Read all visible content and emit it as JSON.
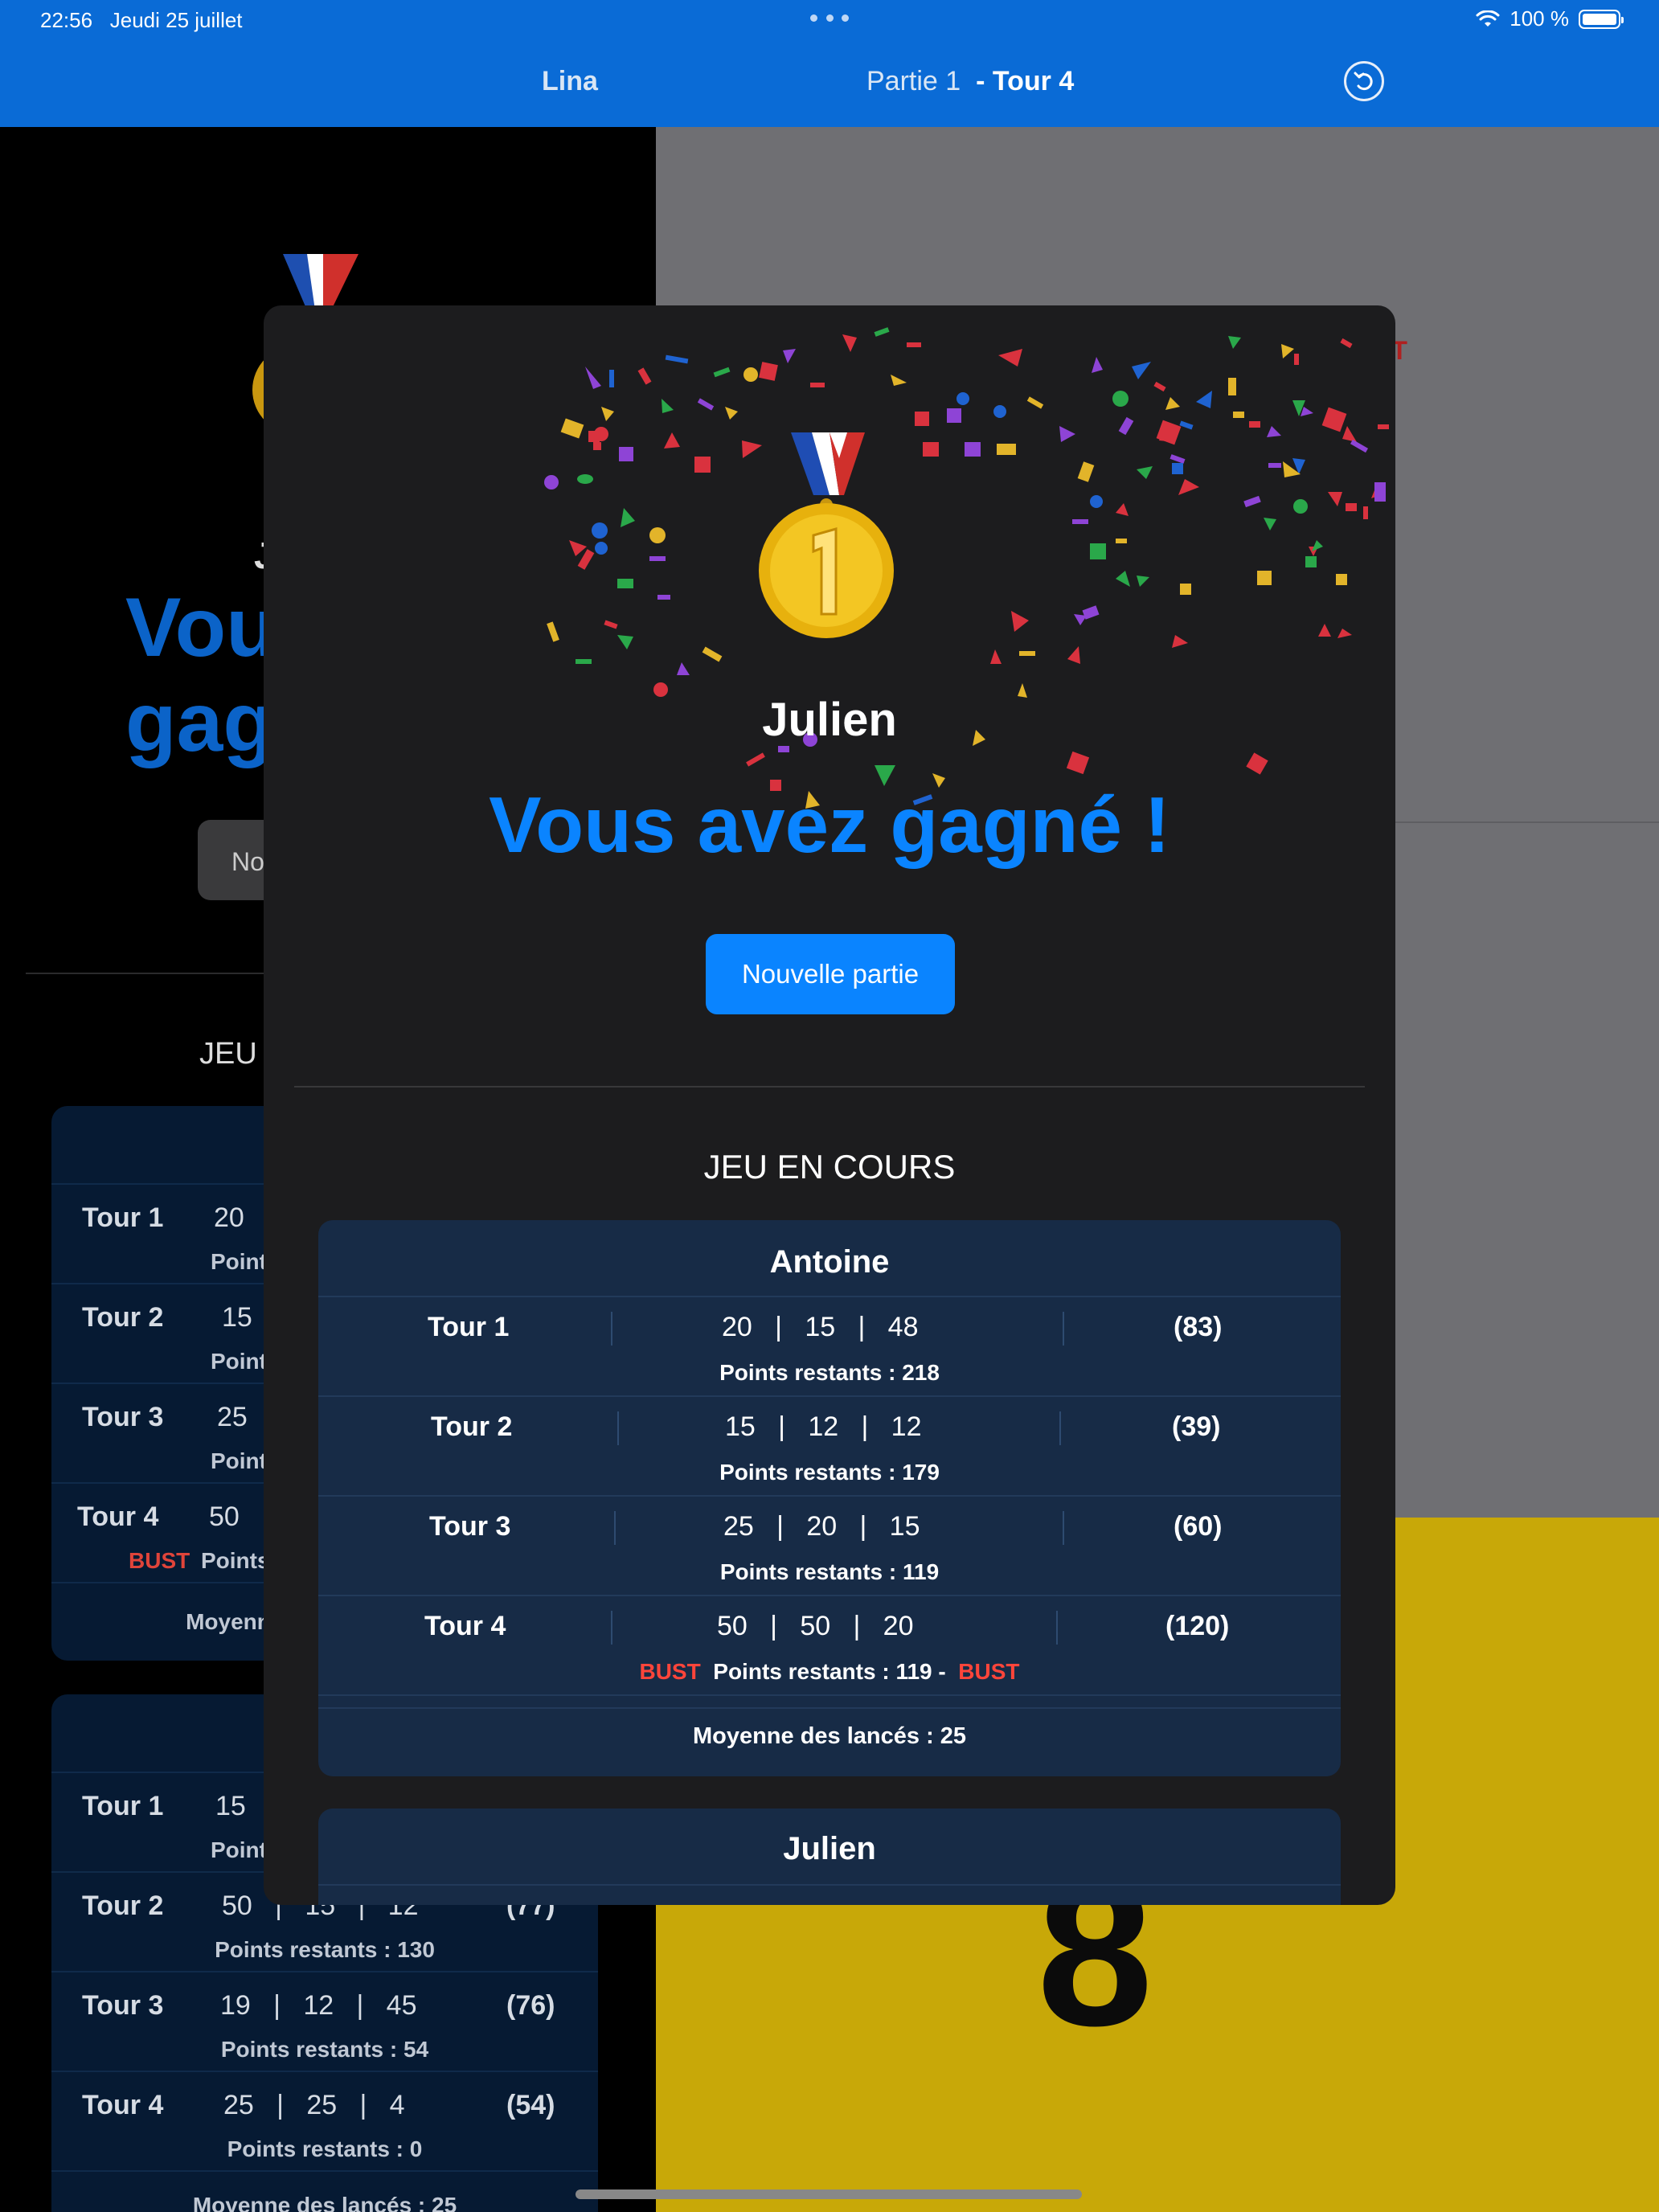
{
  "status": {
    "time": "22:56",
    "date": "Jeudi 25 juillet",
    "battery": "100 %"
  },
  "nav": {
    "left_title": "Lina",
    "game_label": "Partie 1",
    "round_label": "- Tour 4"
  },
  "background": {
    "name_fragment": "J",
    "win_line1": "Vou",
    "win_line2": "gag",
    "button_fragment": "No",
    "section_fragment": "JEU",
    "bust_corner_fragment": "ST",
    "big_number_fragment": "8",
    "card1_rows": [
      {
        "tour": "Tour 1",
        "values": "20",
        "sub": "Point",
        "bust": ""
      },
      {
        "tour": "Tour 2",
        "values": "15",
        "sub": "Point",
        "bust": ""
      },
      {
        "tour": "Tour 3",
        "values": "25",
        "sub": "Point",
        "bust": ""
      },
      {
        "tour": "Tour 4",
        "values": "50",
        "sub": "Points",
        "bust": "BUST"
      }
    ],
    "card1_avg": "Moyenn",
    "card2_rows": [
      {
        "tour": "Tour 1",
        "values": "15",
        "total": "",
        "sub": "Point"
      },
      {
        "tour": "Tour 2",
        "values": "50   |   15   |   12",
        "total": "(77)",
        "sub": "Points restants : 130"
      },
      {
        "tour": "Tour 3",
        "values": "19   |   12   |   45",
        "total": "(76)",
        "sub": "Points restants : 54"
      },
      {
        "tour": "Tour 4",
        "values": "25   |   25   |   4",
        "total": "(54)",
        "sub": "Points restants : 0"
      }
    ],
    "card2_avg": "Moyenne des lancés : 25"
  },
  "modal": {
    "winner": "Julien",
    "title": "Vous avez gagné !",
    "new_game_button": "Nouvelle partie",
    "section_title": "JEU EN COURS",
    "players": [
      {
        "name": "Antoine",
        "rounds": [
          {
            "tour": "Tour 1",
            "throws": "20   |   15   |   48",
            "total": "(83)",
            "remaining": "Points restants : 218",
            "bust_left": "",
            "bust_right": ""
          },
          {
            "tour": "Tour 2",
            "throws": "15   |   12   |   12",
            "total": "(39)",
            "remaining": "Points restants : 179",
            "bust_left": "",
            "bust_right": ""
          },
          {
            "tour": "Tour 3",
            "throws": "25   |   20   |   15",
            "total": "(60)",
            "remaining": "Points restants : 119",
            "bust_left": "",
            "bust_right": ""
          },
          {
            "tour": "Tour 4",
            "throws": "50   |   50   |   20",
            "total": "(120)",
            "remaining": "Points restants : 119  -",
            "bust_left": "BUST",
            "bust_right": "BUST"
          }
        ],
        "average": "Moyenne des lancés : 25"
      },
      {
        "name": "Julien"
      }
    ]
  },
  "colors": {
    "header": "#0A6BD6",
    "accent": "#0A84FF",
    "bust": "#FF453A",
    "card": "#172B46",
    "modal": "#1C1C1E"
  }
}
